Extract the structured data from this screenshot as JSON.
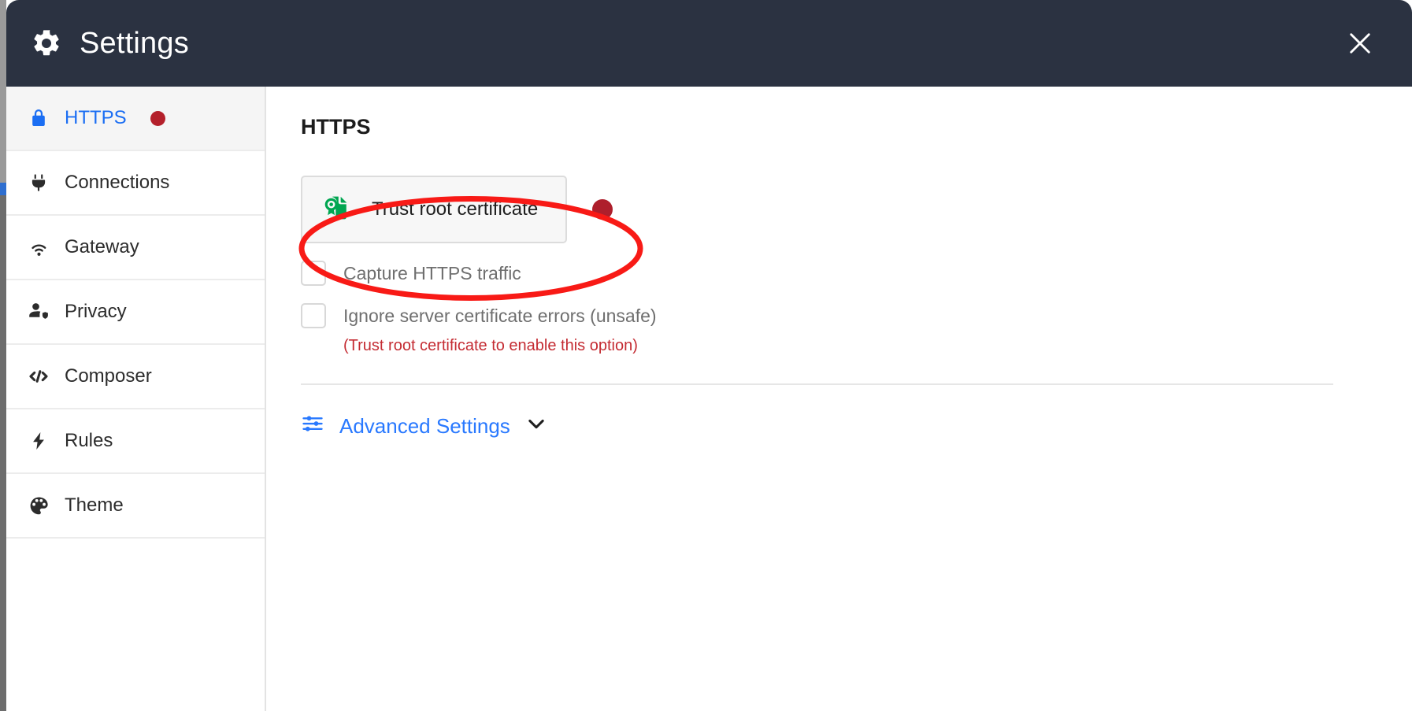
{
  "window": {
    "title": "Settings",
    "gear_icon": "gear-icon",
    "close_icon": "close-icon",
    "header_bg": "#2b3241"
  },
  "sidebar": {
    "items": [
      {
        "label": "HTTPS",
        "icon": "lock-icon",
        "active": true,
        "badge_dot": true,
        "badge_color": "#b4202b"
      },
      {
        "label": "Connections",
        "icon": "plug-icon",
        "active": false,
        "badge_dot": false
      },
      {
        "label": "Gateway",
        "icon": "wifi-icon",
        "active": false,
        "badge_dot": false
      },
      {
        "label": "Privacy",
        "icon": "user-shield-icon",
        "active": false,
        "badge_dot": false
      },
      {
        "label": "Composer",
        "icon": "code-icon",
        "active": false,
        "badge_dot": false
      },
      {
        "label": "Rules",
        "icon": "lightning-icon",
        "active": false,
        "badge_dot": false
      },
      {
        "label": "Theme",
        "icon": "palette-icon",
        "active": false,
        "badge_dot": false
      }
    ],
    "active_color": "#1b6ef3"
  },
  "main": {
    "page_title": "HTTPS",
    "trust_cert_button": {
      "label": "Trust root certificate",
      "icon": "certificate-icon",
      "icon_color": "#00a651",
      "status_dot_color": "#ae1f2c"
    },
    "checkboxes": [
      {
        "label": "Capture HTTPS traffic",
        "checked": false,
        "disabled": true
      },
      {
        "label": "Ignore server certificate errors (unsafe)",
        "checked": false,
        "disabled": true
      }
    ],
    "hint_text": "(Trust root certificate to enable this option)",
    "hint_color": "#c42b32",
    "advanced": {
      "label": "Advanced Settings",
      "icon": "sliders-icon",
      "chevron_icon": "chevron-down-icon",
      "color": "#2979ff"
    }
  },
  "annotation": {
    "shape": "ellipse",
    "color": "#f81a16",
    "target": "Trust root certificate"
  }
}
